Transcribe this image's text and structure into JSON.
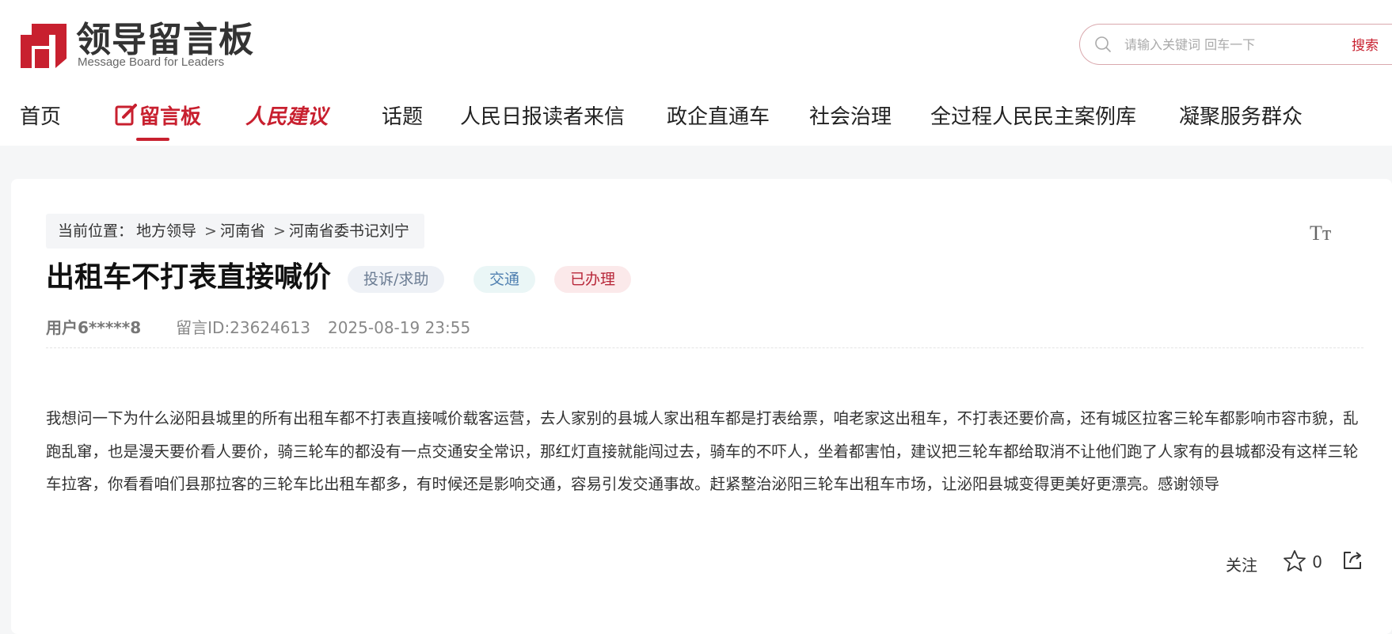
{
  "brand": {
    "name_cn": "领导留言板",
    "name_en": "Message Board for Leaders",
    "accent": "#c8202f"
  },
  "search": {
    "placeholder": "请输入关键词 回车一下",
    "button_label": "搜索",
    "icon": "search-icon"
  },
  "nav": {
    "items": [
      {
        "label": "首页"
      },
      {
        "label": "留言板",
        "active": true,
        "icon": "edit-icon"
      },
      {
        "label": "人民建议"
      },
      {
        "label": "话题"
      },
      {
        "label": "人民日报读者来信"
      },
      {
        "label": "政企直通车"
      },
      {
        "label": "社会治理"
      },
      {
        "label": "全过程人民民主案例库"
      },
      {
        "label": "凝聚服务群众"
      }
    ]
  },
  "breadcrumb": {
    "prefix": "当前位置：",
    "items": [
      "地方领导",
      "河南省",
      "河南省委书记刘宁"
    ],
    "separator": ">"
  },
  "font_size_toggle": {
    "label": "Tт"
  },
  "message": {
    "title": "出租车不打表直接喊价",
    "tags": {
      "type": "投诉/求助",
      "domain": "交通",
      "status": "已办理"
    },
    "user": "用户6*****8",
    "message_id": "留言ID:23624613",
    "datetime": "2025-08-19 23:55",
    "body": "我想问一下为什么泌阳县城里的所有出租车都不打表直接喊价载客运营，去人家别的县城人家出租车都是打表给票，咱老家这出租车，不打表还要价高，还有城区拉客三轮车都影响市容市貌，乱跑乱窜，也是漫天要价看人要价，骑三轮车的都没有一点交通安全常识，那红灯直接就能闯过去，骑车的不吓人，坐着都害怕，建议把三轮车都给取消不让他们跑了人家有的县城都没有这样三轮车拉客，你看看咱们县那拉客的三轮车比出租车都多，有时候还是影响交通，容易引发交通事故。赶紧整治泌阳三轮车出租车市场，让泌阳县城变得更美好更漂亮。感谢领导"
  },
  "actions": {
    "follow_label": "关注",
    "favorite_count": "0",
    "favorite_icon": "star-icon",
    "share_icon": "share-icon"
  }
}
